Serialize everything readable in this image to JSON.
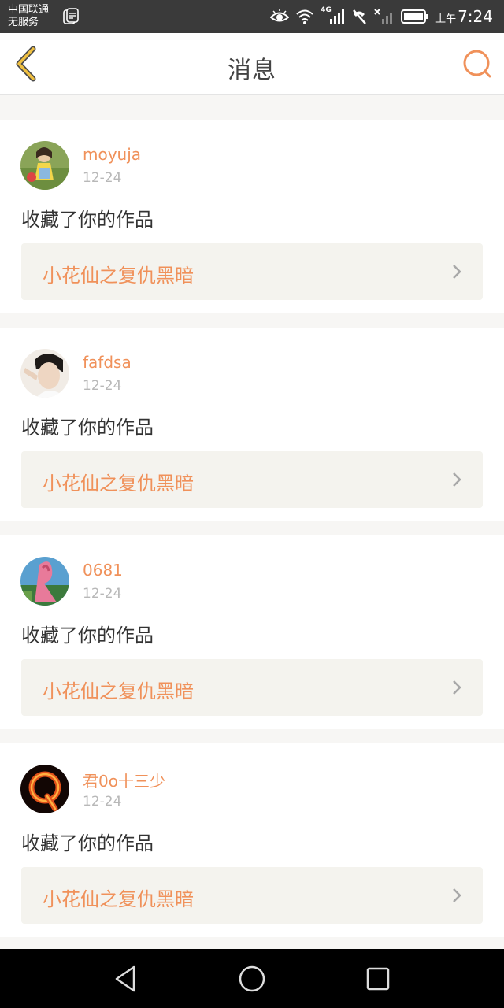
{
  "status_bar": {
    "carrier_line1": "中国联通",
    "carrier_line2": "无服务",
    "network_label": "4G",
    "ampm": "上午",
    "time": "7:24",
    "icons": [
      "document-icon",
      "eye-icon",
      "wifi-icon",
      "signal-icon",
      "no-call-icon",
      "no-signal-icon",
      "battery-icon"
    ]
  },
  "header": {
    "title": "消息",
    "back_icon": "chevron-left-icon",
    "search_icon": "search-icon",
    "accent_color": "#f0915a"
  },
  "messages": [
    {
      "username": "moyuja",
      "date": "12-24",
      "action": "收藏了你的作品",
      "work_title": "小花仙之复仇黑暗"
    },
    {
      "username": "fafdsa",
      "date": "12-24",
      "action": "收藏了你的作品",
      "work_title": "小花仙之复仇黑暗"
    },
    {
      "username": "0681",
      "date": "12-24",
      "action": "收藏了你的作品",
      "work_title": "小花仙之复仇黑暗"
    },
    {
      "username": "君0o十三少",
      "date": "12-24",
      "action": "收藏了你的作品",
      "work_title": "小花仙之复仇黑暗"
    }
  ],
  "nav_bar": {
    "icons": [
      "back-triangle-icon",
      "home-circle-icon",
      "recents-square-icon"
    ]
  }
}
